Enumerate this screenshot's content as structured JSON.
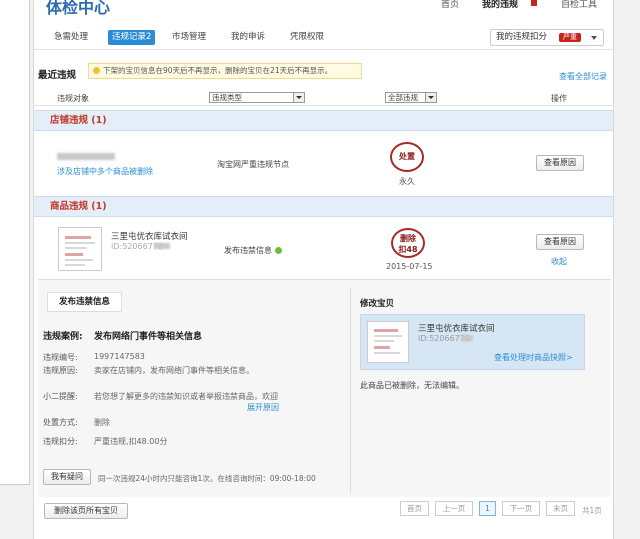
{
  "header": {
    "title": "体检中心",
    "nav": [
      "首页",
      "我的违规",
      "自检工具"
    ]
  },
  "tabs": [
    {
      "label": "急需处理",
      "active": false
    },
    {
      "label": "违规记录2",
      "active": true
    },
    {
      "label": "市场管理",
      "active": false
    },
    {
      "label": "我的申诉",
      "active": false
    },
    {
      "label": "凭限权限",
      "active": false
    }
  ],
  "my_button": {
    "label": "我的违规扣分",
    "badge": "严重"
  },
  "recent": {
    "title": "最近违规",
    "notice": "下架的宝贝信息在90天后不再显示，删除的宝贝在21天后不再显示。",
    "view_all": "查看全部记录"
  },
  "columns": {
    "object": "违规对象",
    "type_select": "违规类型",
    "status_select": "全部违规",
    "action": "操作"
  },
  "shop_section": {
    "title": "店铺违规 (1)",
    "link": "涉及店铺中多个商品被删除",
    "node": "淘宝网严重违规节点",
    "stamp": "处置",
    "duration": "永久",
    "button": "查看原因"
  },
  "goods_section": {
    "title": "商品违规 (1)",
    "name": "三里屯优衣库试衣间",
    "id_label": "ID:52066775",
    "reason": "发布违禁信息",
    "stamp_line1": "删除",
    "stamp_line2": "扣48",
    "date": "2015-07-15",
    "button": "查看原因",
    "collapse": "收起"
  },
  "detail": {
    "tab": "发布违禁信息",
    "case_label": "违规案例:",
    "case_title": "发布网络门事件等相关信息",
    "number_label": "违规编号:",
    "number": "1997147583",
    "reason_label": "违规原因:",
    "reason": "卖家在店铺内，发布网络门事件等相关信息。",
    "tip_label": "小二提醒:",
    "tip": "若您想了解更多的违禁知识或者举报违禁商品，欢迎",
    "tip_link": "展开原因",
    "method_label": "处置方式:",
    "method": "删除",
    "deduct_label": "违规扣分:",
    "deduct": "严重违规,扣48.00分",
    "question_button": "我有疑问",
    "question_note": "同一次违规24小时内只能咨询1次。在线咨询时间：09:00-18:00"
  },
  "modify": {
    "title": "修改宝贝",
    "name": "三里屯优衣库试衣间",
    "id_label": "ID:52066775",
    "link": "查看处理时商品快照>",
    "note": "此商品已被删除，无法编辑。"
  },
  "footer": {
    "delete_button": "删除该页所有宝贝",
    "pager": {
      "first": "首页",
      "prev": "上一页",
      "current": "1",
      "next": "下一页",
      "last": "末页",
      "total": "共1页"
    }
  }
}
